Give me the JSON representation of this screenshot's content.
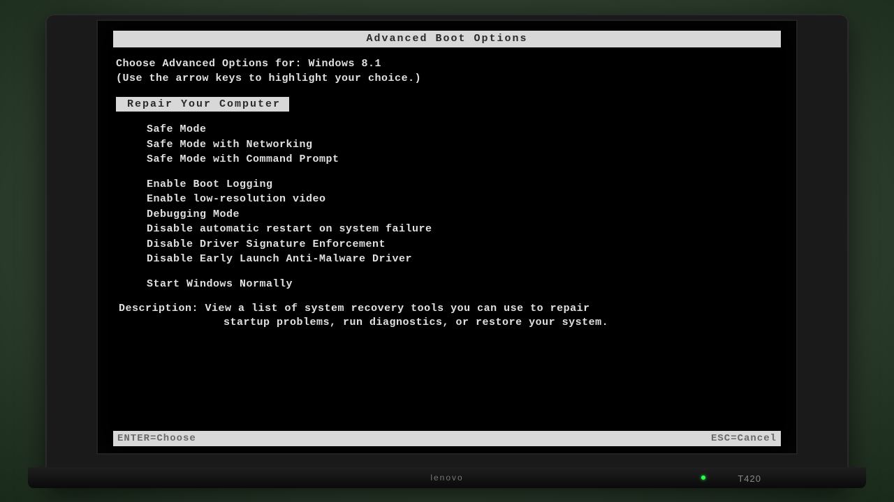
{
  "title_bar": "Advanced Boot Options",
  "prompt": {
    "label": "Choose Advanced Options for: ",
    "os": "Windows 8.1",
    "hint": "(Use the arrow keys to highlight your choice.)"
  },
  "selected_option": "Repair Your Computer",
  "groups": [
    [
      "Safe Mode",
      "Safe Mode with Networking",
      "Safe Mode with Command Prompt"
    ],
    [
      "Enable Boot Logging",
      "Enable low-resolution video",
      "Debugging Mode",
      "Disable automatic restart on system failure",
      "Disable Driver Signature Enforcement",
      "Disable Early Launch Anti-Malware Driver"
    ],
    [
      "Start Windows Normally"
    ]
  ],
  "description": {
    "label": "Description: ",
    "line1": "View a list of system recovery tools you can use to repair",
    "line2": "startup problems, run diagnostics, or restore your system."
  },
  "bottom_bar": {
    "left": "ENTER=Choose",
    "right": "ESC=Cancel"
  },
  "laptop": {
    "brand": "lenovo",
    "model": "T420"
  }
}
